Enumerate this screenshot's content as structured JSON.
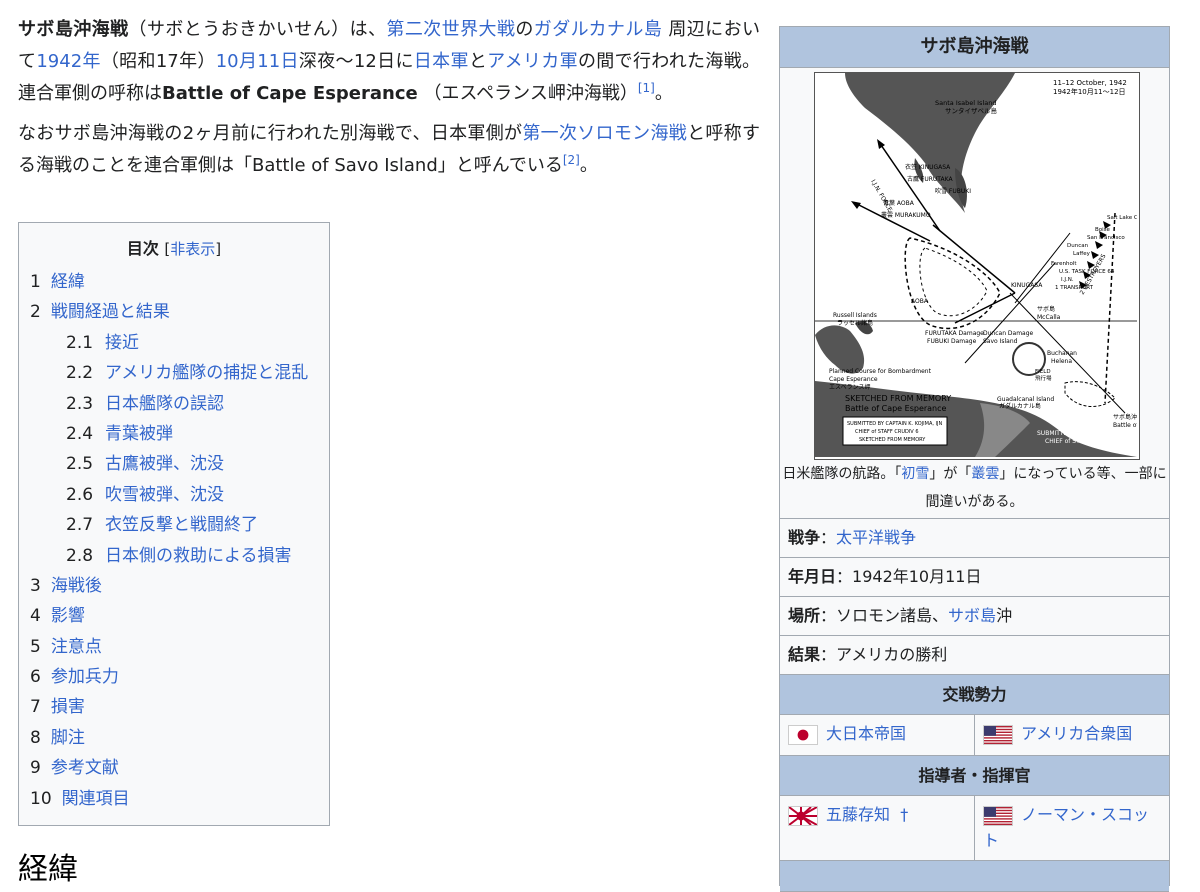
{
  "intro": {
    "term": "サボ島沖海戦",
    "reading": "（サボとうおきかいせん）は、",
    "link_ww2": "第二次世界大戦",
    "t_no": "の",
    "link_guadalcanal": "ガダルカナル島",
    "t_around": " 周辺において",
    "link_1942": "1942年",
    "t_showa": "（昭和17年）",
    "link_oct11": "10月11日",
    "t_night": "深夜〜12日に",
    "link_japan_army": "日本軍",
    "t_to": "と",
    "link_us_army": "アメリカ軍",
    "t_between": "の間で行われた海戦。連合軍側の呼称は",
    "english_name": "Battle of Cape Esperance",
    "t_esperance": " （エスペランス岬沖海戦）",
    "ref1": "[1]",
    "t_end": "。"
  },
  "note": {
    "t1": "なおサボ島沖海戦の2ヶ月前に行われた別海戦で、日本軍側が",
    "link_solomon": "第一次ソロモン海戦",
    "t2": "と呼称する海戦のことを連合軍側は「Battle of Savo Island」と呼んでいる",
    "ref2": "[2]",
    "t3": "。"
  },
  "toc": {
    "title": "目次",
    "toggle_open": "[",
    "toggle": "非表示",
    "toggle_close": "]",
    "items": [
      {
        "num": "1",
        "label": "経緯"
      },
      {
        "num": "2",
        "label": "戦闘経過と結果"
      },
      {
        "num": "2.1",
        "label": "接近"
      },
      {
        "num": "2.2",
        "label": "アメリカ艦隊の捕捉と混乱"
      },
      {
        "num": "2.3",
        "label": "日本艦隊の誤認"
      },
      {
        "num": "2.4",
        "label": "青葉被弾"
      },
      {
        "num": "2.5",
        "label": "古鷹被弾、沈没"
      },
      {
        "num": "2.6",
        "label": "吹雪被弾、沈没"
      },
      {
        "num": "2.7",
        "label": "衣笠反撃と戦闘終了"
      },
      {
        "num": "2.8",
        "label": "日本側の救助による損害"
      },
      {
        "num": "3",
        "label": "海戦後"
      },
      {
        "num": "4",
        "label": "影響"
      },
      {
        "num": "5",
        "label": "注意点"
      },
      {
        "num": "6",
        "label": "参加兵力"
      },
      {
        "num": "7",
        "label": "損害"
      },
      {
        "num": "8",
        "label": "脚注"
      },
      {
        "num": "9",
        "label": "参考文献"
      },
      {
        "num": "10",
        "label": "関連項目"
      }
    ]
  },
  "next_heading": "経緯",
  "infobox": {
    "title": "サボ島沖海戦",
    "map": {
      "date_en": "11–12 October, 1942",
      "date_ja": "1942年10月11〜12日",
      "santa_isabel": "Santa Isabel Island",
      "santa_isabel_ja": "サンタイザベル島",
      "ijn_force": "I.J.N. FORCE",
      "kinugasa": "衣笠 KINUGASA",
      "furutaka": "古鷹 FURUTAKA",
      "fubuki": "吹雪 FUBUKI",
      "aoba": "青葉 AOBA",
      "murakumo": "叢雲 MURAKUMO",
      "kinugasa2": "KINUGASA",
      "aoba2": "AOBA",
      "russell": "Russell Islands",
      "russell_ja": "ラッセル諸島",
      "furutaka_damage": "FURUTAKA Damage",
      "fubuki_damage": "FUBUKI Damage",
      "duncan_damage": "Duncan Damage",
      "savo": "Savo Island",
      "savo_ja": "サボ島",
      "mccalla": "McCalla",
      "buchanan": "Buchanan",
      "helena": "Helena",
      "salt_lake": "Salt Lake City",
      "boise": "Boise",
      "san_francisco": "San Francisco",
      "duncan": "Duncan",
      "laffey": "Laffey",
      "farenholt": "Farenholt",
      "us_tf": "U.S. TASK FORCE 64",
      "ijn2": "I.J.N.",
      "transport": "1 TRANSPORT",
      "destroyers": "2 DESTROYERS",
      "planned": "Planned Course for Bombardment",
      "cape_esperance": "Cape Esperance",
      "cape_esperance_ja": "エスペランス岬",
      "field": "FIELD",
      "field_ja": "飛行場",
      "guadalcanal": "Guadalcanal Island",
      "guadalcanal_ja": "ガダルカナル島",
      "battle_ja": "サボ島沖海戦",
      "battle_en": "Battle of Cape Esperance",
      "submitted": "SUBMITTED BY CAPTAIN K. KOJIMA, IJN",
      "chief": "CHIEF of STAFF CRUDIV 6",
      "sketched": "SKETCHED FROM MEMORY"
    },
    "caption_pre": "日米艦隊の航路。「",
    "caption_link1": "初雪",
    "caption_mid": "」が「",
    "caption_link2": "叢雲",
    "caption_post": "」になっている等、一部に間違いがある。",
    "war_label": "戦争",
    "war_sep": "：",
    "war_value": "太平洋戦争",
    "date_label": "年月日",
    "date_sep": "：",
    "date_value": "1942年10月11日",
    "place_label": "場所",
    "place_sep": "：",
    "place_pre": "ソロモン諸島、",
    "place_link": "サボ島",
    "place_post": "沖",
    "result_label": "結果",
    "result_sep": "：",
    "result_value": "アメリカの勝利",
    "belligerents_header": "交戦勢力",
    "belligerent_jp": "大日本帝国",
    "belligerent_us": "アメリカ合衆国",
    "commanders_header": "指導者・指揮官",
    "commander_jp": "五藤存知",
    "commander_jp_mark": "†",
    "commander_us": "ノーマン・スコット"
  },
  "colors": {
    "link": "#3366cc",
    "infobox_header": "#b0c4de",
    "infobox_bg": "#f8f9fa",
    "border": "#a2a9b1",
    "text": "#202122"
  }
}
